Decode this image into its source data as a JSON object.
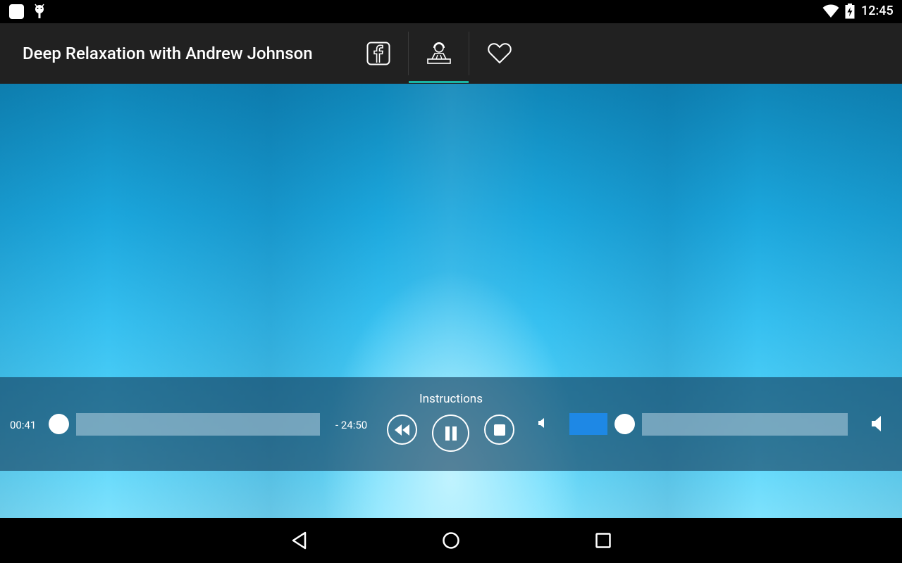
{
  "status_bar": {
    "time": "12:45",
    "icons": [
      "notification-square-icon",
      "android-debug-icon",
      "wifi-icon",
      "battery-charging-icon"
    ]
  },
  "app_bar": {
    "title": "Deep Relaxation with Andrew Johnson",
    "actions": [
      {
        "name": "facebook-icon",
        "selected": false
      },
      {
        "name": "dj-mixer-icon",
        "selected": true
      },
      {
        "name": "heart-icon",
        "selected": false
      }
    ],
    "accent_color": "#1bb5a5"
  },
  "player": {
    "track_title": "Instructions",
    "elapsed": "00:41",
    "remaining": "- 24:50",
    "seek_progress": 0.03,
    "volume_level": 0.15,
    "volume_color": "#1e88e5",
    "controls": [
      "rewind-icon",
      "pause-icon",
      "stop-icon"
    ]
  },
  "nav_bar": {
    "buttons": [
      "back-icon",
      "home-icon",
      "recent-apps-icon"
    ]
  }
}
